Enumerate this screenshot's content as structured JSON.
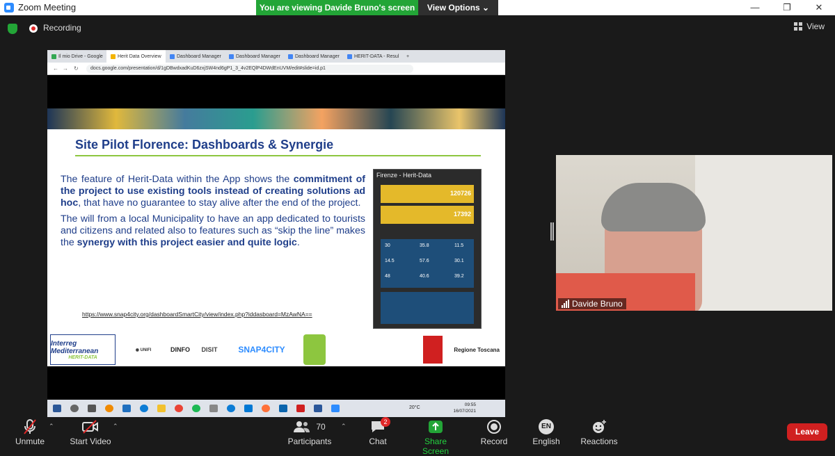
{
  "window": {
    "title": "Zoom Meeting",
    "banner": "You are viewing Davide Bruno's screen",
    "view_options": "View Options"
  },
  "topbar": {
    "recording": "Recording",
    "view": "View"
  },
  "browser": {
    "tabs": [
      "Il mio Drive - Google",
      "Herit Data Overview",
      "Dashboard Manager",
      "Dashboard Manager",
      "Dashboard Manager",
      "HERIT-DATA - Resul"
    ],
    "url": "docs.google.com/presentation/d/1gDBwdxadKuD6zxjSW4nd6gP1_3_4v2EQlP4DWdEnUVM/edit#slide=id.p1"
  },
  "slide": {
    "title": "Site Pilot Florence: Dashboards & Synergie",
    "p1_a": "The feature of Herit-Data within the App shows the ",
    "p1_b": "commitment of the project to use existing tools instead of creating solutions ad hoc",
    "p1_c": ", that have no guarantee to stay alive after the end of the project.",
    "p2_a": "The will from a local Municipality to have an app dedicated to tourists and citizens and related also to features such as “skip the line” makes the ",
    "p2_b": "synergy with this project easier and quite logic",
    "p2_c": ".",
    "link": "https://www.snap4city.org/dashboardSmartCity/view/index.php?iddasboard=MzAwNA==",
    "dashboard_title": "Firenze - Herit-Data",
    "dash_vals": [
      "120726",
      "17392",
      "30",
      "35.8",
      "11.5",
      "14.5",
      "57.6",
      "30.1",
      "48",
      "40.6",
      "39.2"
    ],
    "logos": [
      "Interreg Mediterranean",
      "HERIT-DATA",
      "DINFO",
      "DISIT",
      "SNAP4CITY",
      "Regione Toscana"
    ]
  },
  "taskbar": {
    "temp": "20°C",
    "time": "09:55",
    "date": "16/07/2021"
  },
  "video": {
    "name": "Davide Bruno"
  },
  "footer": {
    "unmute": "Unmute",
    "start_video": "Start Video",
    "participants": "Participants",
    "participants_count": "70",
    "chat": "Chat",
    "chat_badge": "2",
    "share_screen": "Share Screen",
    "record": "Record",
    "language": "English",
    "language_code": "EN",
    "reactions": "Reactions",
    "leave": "Leave"
  },
  "colors": {
    "green": "#23a537",
    "leave": "#d02020",
    "slide_blue": "#1f3e8a"
  }
}
